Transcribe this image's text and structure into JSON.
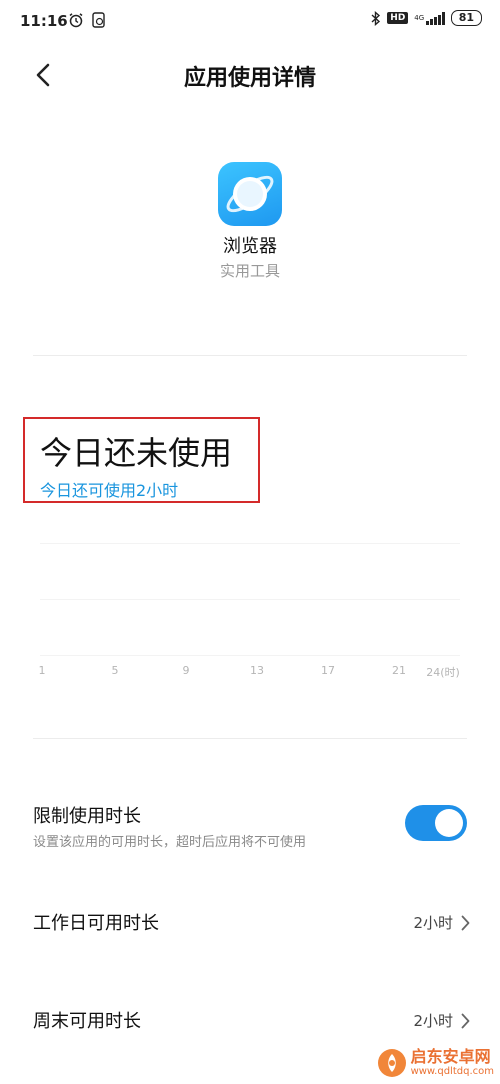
{
  "status_bar": {
    "time": "11:16",
    "network": "4G",
    "hd": "HD",
    "battery": "81"
  },
  "header": {
    "title": "应用使用详情"
  },
  "app": {
    "name": "浏览器",
    "category": "实用工具"
  },
  "usage": {
    "title": "今日还未使用",
    "remaining": "今日还可使用2小时"
  },
  "chart_data": {
    "type": "bar",
    "categories": [
      "1",
      "5",
      "9",
      "13",
      "17",
      "21",
      "24(时)"
    ],
    "values": [
      0,
      0,
      0,
      0,
      0,
      0,
      0
    ]
  },
  "settings": {
    "limit": {
      "title": "限制使用时长",
      "desc": "设置该应用的可用时长，超时后应用将不可使用",
      "enabled": true
    },
    "weekday": {
      "title": "工作日可用时长",
      "value": "2小时"
    },
    "weekend": {
      "title": "周末可用时长",
      "value": "2小时"
    }
  },
  "watermark": {
    "name": "启东安卓网",
    "url": "www.qdltdq.com"
  },
  "colors": {
    "accent": "#1f90e8",
    "link": "#1a95de",
    "highlight": "#d42a2a"
  }
}
